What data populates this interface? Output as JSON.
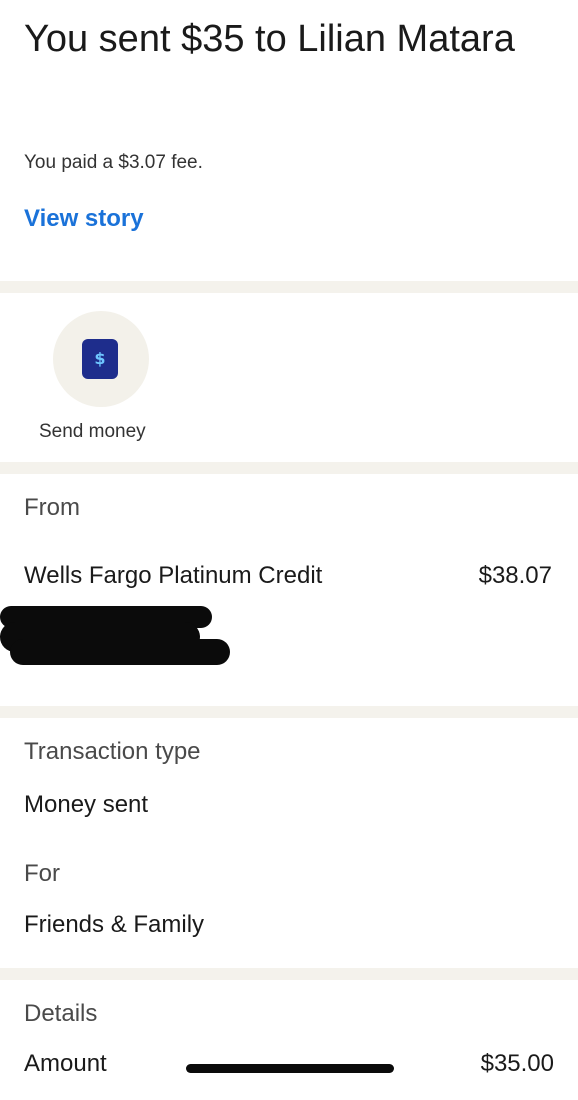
{
  "hero": {
    "title": "You sent $35 to Lilian Matara",
    "fee": "You paid a $3.07 fee.",
    "view_story": "View story"
  },
  "action": {
    "icon": "dollar-icon",
    "icon_glyph": "$",
    "label": "Send money"
  },
  "from": {
    "label": "From",
    "account_name": "Wells Fargo Platinum Credit",
    "amount": "$38.07"
  },
  "transaction": {
    "type_label": "Transaction type",
    "type_value": "Money sent",
    "for_label": "For",
    "for_value": "Friends & Family"
  },
  "details": {
    "label": "Details",
    "amount_label": "Amount",
    "amount_value": "$35.00"
  },
  "colors": {
    "link": "#1a72d9",
    "divider": "#f4f2ec",
    "icon_bg": "#1e2d8c"
  }
}
